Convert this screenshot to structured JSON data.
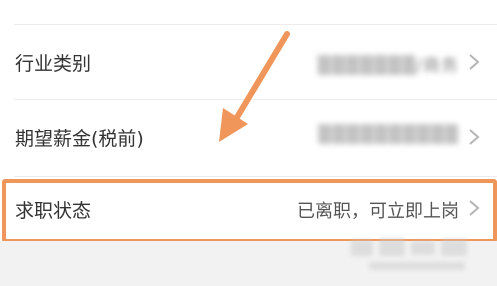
{
  "rows": [
    {
      "label": "行业类别",
      "value_blurred": "▒▒▒▒▒▒▒/商务"
    },
    {
      "label": "期望薪金(税前)",
      "value_blurred": "▒▒▒▒▒▒▒▒▒▒"
    },
    {
      "label": "求职状态",
      "value": "已离职，可立即上岗"
    }
  ],
  "colors": {
    "highlight": "#f0965a",
    "arrow": "#f0965a"
  },
  "icons": {
    "row_chevron": "chevron-right-icon",
    "annotation_arrow": "arrow-annotation"
  }
}
